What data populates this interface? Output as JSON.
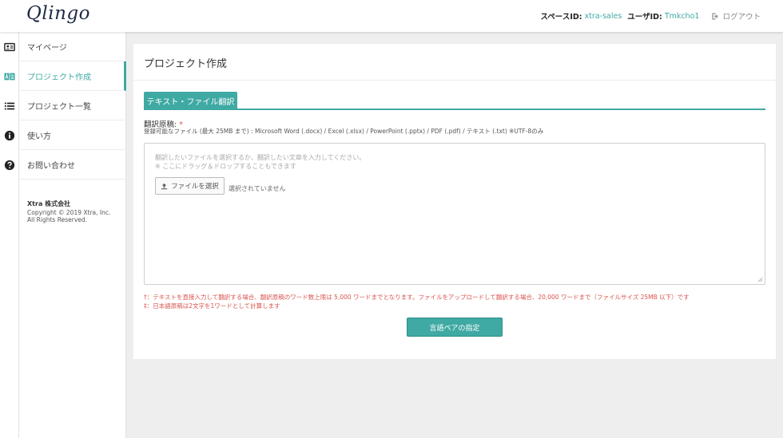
{
  "header": {
    "logo": "Qlingo",
    "space_label": "スペースID:",
    "space_value": "xtra-sales",
    "user_label": "ユーザID:",
    "user_value": "Tmkcho1",
    "logout_label": "ログアウト",
    "logout_icon": "logout-icon"
  },
  "sidebar": {
    "items": [
      {
        "label": "マイページ",
        "icon": "id-card-icon"
      },
      {
        "label": "プロジェクト作成",
        "icon": "translate-icon",
        "active": true
      },
      {
        "label": "プロジェクト一覧",
        "icon": "list-icon"
      },
      {
        "label": "使い方",
        "icon": "info-icon"
      },
      {
        "label": "お問い合わせ",
        "icon": "question-icon"
      }
    ],
    "company": "Xtra 株式会社",
    "copyright": "Copyright © 2019 Xtra, Inc. All Rights Reserved."
  },
  "main": {
    "title": "プロジェクト作成",
    "tab_label": "テキスト・ファイル翻訳",
    "field_label": "翻訳原稿:",
    "required_mark": "*",
    "formats": "登録可能なファイル (最大 25MB まで) : Microsoft Word (.docx) / Excel (.xlsx) / PowerPoint (.pptx) / PDF (.pdf) / テキスト (.txt) ※UTF-8のみ",
    "dropzone": {
      "placeholder_line1": "翻訳したいファイルを選択するか、翻訳したい文章を入力してください。",
      "placeholder_line2": "※ ここにドラッグ＆ドロップすることもできます",
      "file_button": "ファイルを選択",
      "file_status": "選択されていません"
    },
    "note1": "†：テキストを直接入力して翻訳する場合、翻訳原稿のワード数上限は 5,000 ワードまでとなります。ファイルをアップロードして翻訳する場合、20,000 ワードまで（ファイルサイズ 25MB 以下）です",
    "note2": "‡：日本語原稿は2文字を1ワードとして計算します",
    "submit_button": "言語ペアの指定"
  },
  "colors": {
    "accent": "#3fa9a3",
    "warning": "#d9534f",
    "logo": "#1f2a44"
  }
}
